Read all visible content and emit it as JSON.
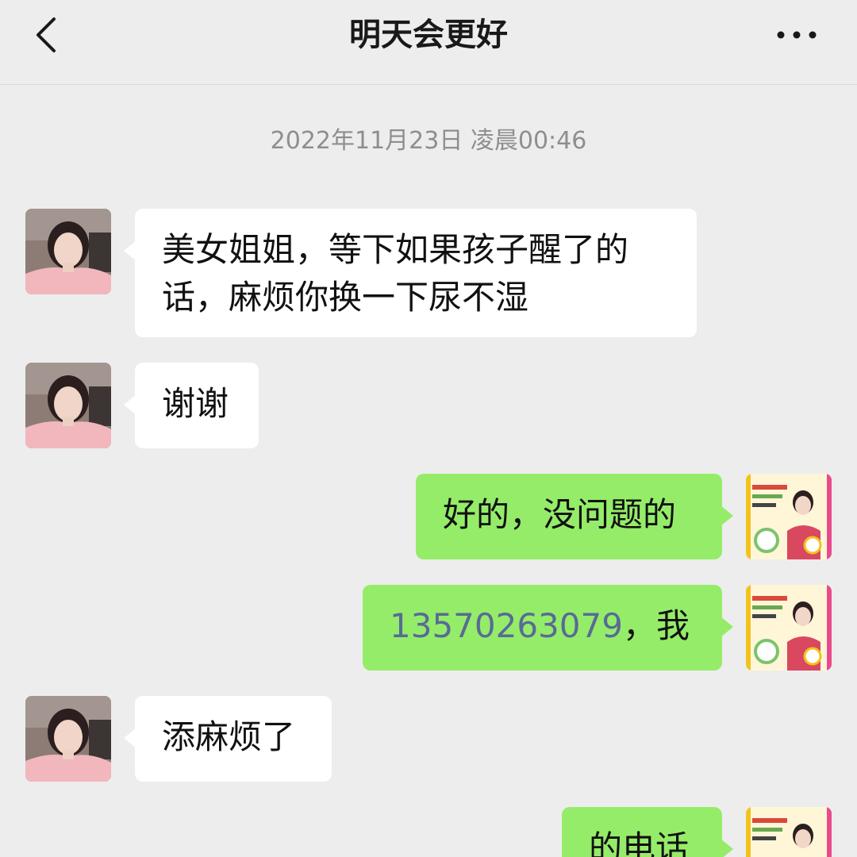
{
  "header": {
    "title": "明天会更好",
    "back_icon": "chevron-left-icon",
    "more_icon": "more-dots-icon"
  },
  "timestamp": "2022年11月23日 凌晨00:46",
  "messages": [
    {
      "side": "incoming",
      "text_line1": "美女姐姐，等下如果孩子醒了的",
      "text_line2": "话，麻烦你换一下尿不湿"
    },
    {
      "side": "incoming",
      "text": "谢谢"
    },
    {
      "side": "outgoing",
      "text": "好的，没问题的"
    },
    {
      "side": "outgoing",
      "phone": "13570263079",
      "text": "，我"
    },
    {
      "side": "incoming",
      "text": "添麻烦了"
    },
    {
      "side": "outgoing",
      "text": "的电话"
    }
  ],
  "colors": {
    "background": "#ededed",
    "incoming_bubble": "#ffffff",
    "outgoing_bubble": "#95ec69",
    "link": "#576b95",
    "timestamp": "#8e8e8e"
  }
}
